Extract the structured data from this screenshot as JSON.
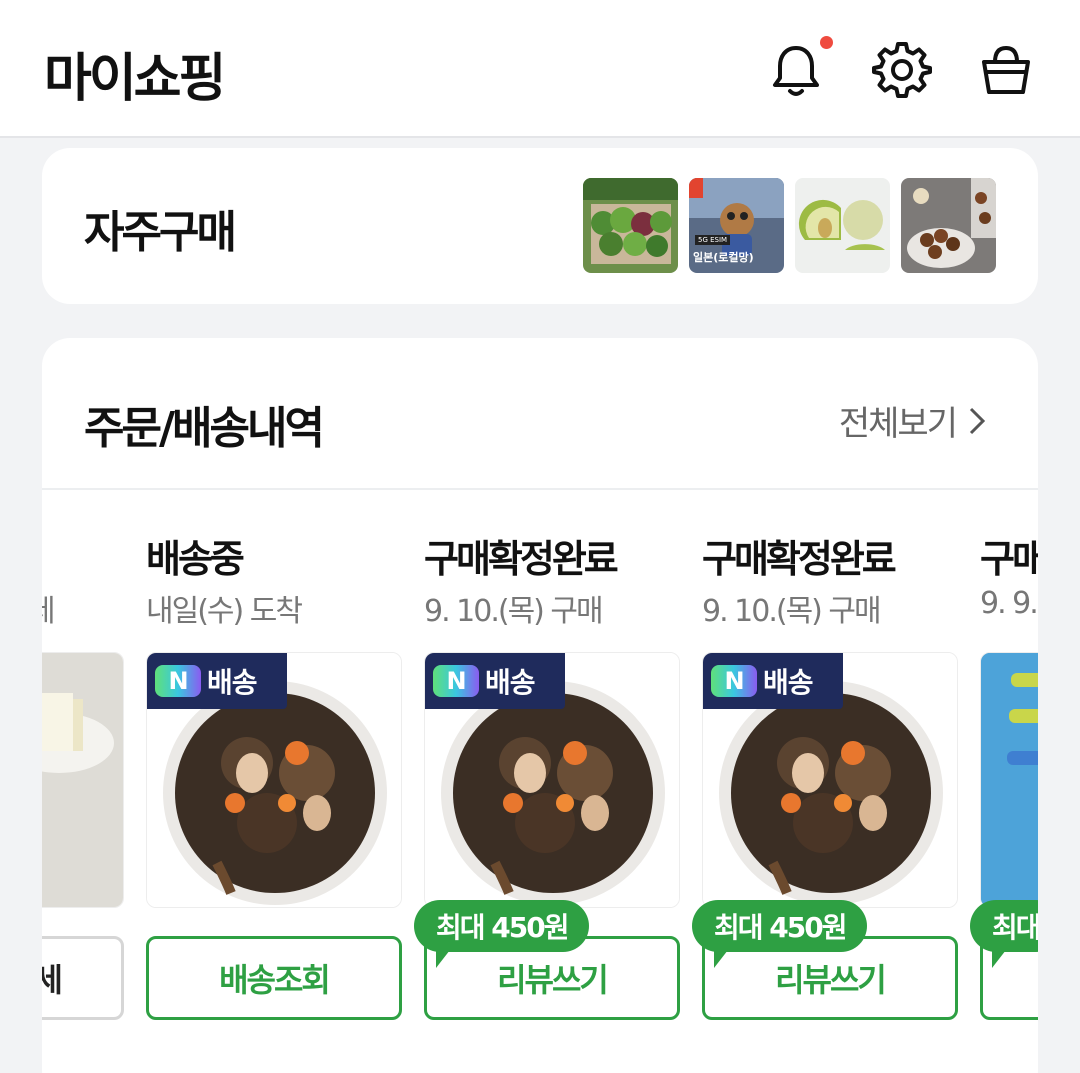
{
  "header": {
    "title": "마이쇼핑"
  },
  "frequent": {
    "title": "자주구매",
    "esim_label": "일본(로컬망)",
    "esim_tag": "5G ESIM"
  },
  "orders": {
    "title": "주문/배송내역",
    "view_all": "전체보기",
    "badge_text": "배송",
    "badge_n": "N",
    "items": [
      {
        "status": "",
        "sub": "세",
        "button": "세"
      },
      {
        "status": "배송중",
        "sub": "내일(수) 도착",
        "button": "배송조회"
      },
      {
        "status": "구매확정완료",
        "sub": "9. 10.(목) 구매",
        "button": "리뷰쓰기",
        "tip": "최대 450원"
      },
      {
        "status": "구매확정완료",
        "sub": "9. 10.(목) 구매",
        "button": "리뷰쓰기",
        "tip": "최대 450원"
      },
      {
        "status": "구매",
        "sub": "9. 9.",
        "button": "",
        "tip": "최대"
      }
    ]
  },
  "colors": {
    "accent_green": "#2ea043",
    "badge_navy": "#1f2b5c",
    "notif_dot": "#ef4b3f"
  }
}
